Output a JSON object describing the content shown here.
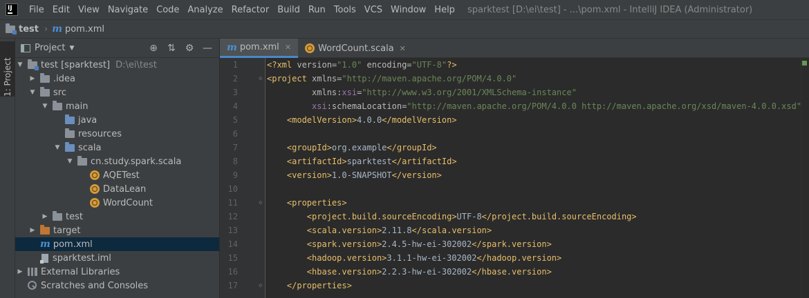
{
  "menubar": {
    "items": [
      "File",
      "Edit",
      "View",
      "Navigate",
      "Code",
      "Analyze",
      "Refactor",
      "Build",
      "Run",
      "Tools",
      "VCS",
      "Window",
      "Help"
    ],
    "window_title": "sparktest [D:\\ei\\test] - ...\\pom.xml - IntelliJ IDEA (Administrator)"
  },
  "navbar": {
    "project": "test",
    "file": "pom.xml"
  },
  "toolstrip": {
    "label": "1: Project"
  },
  "project_panel": {
    "title": "Project",
    "tree": [
      {
        "label": "test [sparktest]",
        "hint": "D:\\ei\\test"
      },
      {
        "label": ".idea"
      },
      {
        "label": "src"
      },
      {
        "label": "main"
      },
      {
        "label": "java"
      },
      {
        "label": "resources"
      },
      {
        "label": "scala"
      },
      {
        "label": "cn.study.spark.scala"
      },
      {
        "label": "AQETest"
      },
      {
        "label": "DataLean"
      },
      {
        "label": "WordCount"
      },
      {
        "label": "test"
      },
      {
        "label": "target"
      },
      {
        "label": "pom.xml"
      },
      {
        "label": "sparktest.iml"
      },
      {
        "label": "External Libraries"
      },
      {
        "label": "Scratches and Consoles"
      }
    ]
  },
  "editor": {
    "tabs": [
      {
        "label": "pom.xml",
        "active": true
      },
      {
        "label": "WordCount.scala",
        "active": false
      }
    ],
    "line_numbers": [
      "1",
      "2",
      "3",
      "4",
      "5",
      "6",
      "7",
      "8",
      "9",
      "10",
      "11",
      "12",
      "13",
      "14",
      "15",
      "16",
      "17"
    ],
    "lines": [
      [
        [
          "pi",
          "<?xml "
        ],
        [
          "at",
          "version="
        ],
        [
          "av",
          "\"1.0\""
        ],
        [
          "at",
          " encoding="
        ],
        [
          "av",
          "\"UTF-8\""
        ],
        [
          "pi",
          "?>"
        ]
      ],
      [
        [
          "tg",
          "<project "
        ],
        [
          "at",
          "xmlns="
        ],
        [
          "av",
          "\"http://maven.apache.org/POM/4.0.0\""
        ]
      ],
      [
        [
          "at",
          "         xmlns:"
        ],
        [
          "ns",
          "xsi"
        ],
        [
          "at",
          "="
        ],
        [
          "av",
          "\"http://www.w3.org/2001/XMLSchema-instance\""
        ]
      ],
      [
        [
          "ns",
          "         xsi"
        ],
        [
          "at",
          ":schemaLocation="
        ],
        [
          "av",
          "\"http://maven.apache.org/POM/4.0.0 http://maven.apache.org/xsd/maven-4.0.0.xsd\""
        ],
        [
          "tg",
          ">"
        ]
      ],
      [
        [
          "tg",
          "    <modelVersion>"
        ],
        [
          "tx",
          "4.0.0"
        ],
        [
          "tg",
          "</modelVersion>"
        ]
      ],
      [],
      [
        [
          "tg",
          "    <groupId>"
        ],
        [
          "tx",
          "org.example"
        ],
        [
          "tg",
          "</groupId>"
        ]
      ],
      [
        [
          "tg",
          "    <artifactId>"
        ],
        [
          "tx",
          "sparktest"
        ],
        [
          "tg",
          "</artifactId>"
        ]
      ],
      [
        [
          "tg",
          "    <version>"
        ],
        [
          "tx",
          "1.0-SNAPSHOT"
        ],
        [
          "tg",
          "</version>"
        ]
      ],
      [],
      [
        [
          "tg",
          "    <properties>"
        ]
      ],
      [
        [
          "tg",
          "        <project.build.sourceEncoding>"
        ],
        [
          "tx",
          "UTF-8"
        ],
        [
          "tg",
          "</project.build.sourceEncoding>"
        ]
      ],
      [
        [
          "tg",
          "        <scala.version>"
        ],
        [
          "tx",
          "2.11.8"
        ],
        [
          "tg",
          "</scala.version>"
        ]
      ],
      [
        [
          "tg",
          "        <spark.version>"
        ],
        [
          "tx",
          "2.4.5-hw-ei-302002"
        ],
        [
          "tg",
          "</spark.version>"
        ]
      ],
      [
        [
          "tg",
          "        <hadoop.version>"
        ],
        [
          "tx",
          "3.1.1-hw-ei-302002"
        ],
        [
          "tg",
          "</hadoop.version>"
        ]
      ],
      [
        [
          "tg",
          "        <hbase.version>"
        ],
        [
          "tx",
          "2.2.3-hw-ei-302002"
        ],
        [
          "tg",
          "</hbase.version>"
        ]
      ],
      [
        [
          "tg",
          "    </properties>"
        ]
      ]
    ]
  }
}
